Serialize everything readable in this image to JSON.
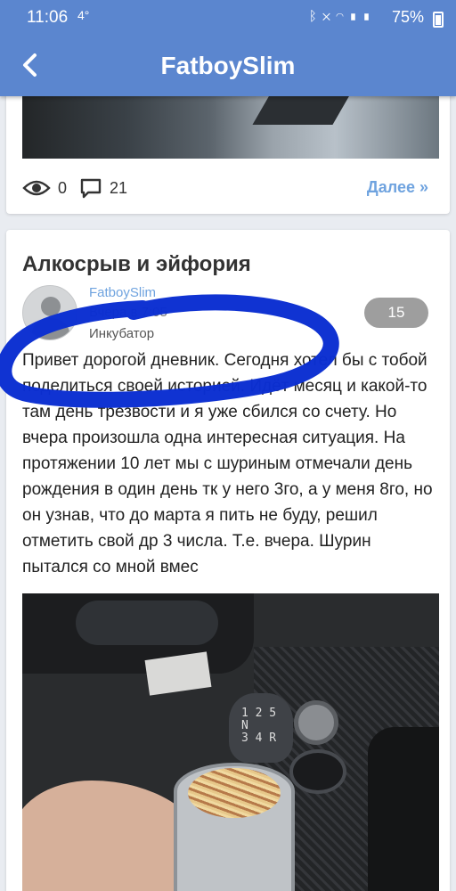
{
  "status_bar": {
    "time": "11:06",
    "temperature": "4°",
    "battery": "75%",
    "icons": [
      "bluetooth-icon",
      "mute-icon",
      "wifi-icon",
      "signal-icon",
      "signal-icon",
      "battery-icon"
    ]
  },
  "app_bar": {
    "title": "FatboySlim",
    "back_icon": "back-arrow-icon",
    "color": "#5b86cf"
  },
  "previous_post": {
    "views": "0",
    "comments": "21",
    "more_label": "Далее »"
  },
  "post": {
    "title": "Алкосрыв и эйфория",
    "author": "FatboySlim",
    "date": "Вчера в 7:05",
    "group": "Инкубатор",
    "badge": "15",
    "text": "Привет дорогой дневник. Сегодня хотел бы с тобой поделиться своей историей. Идёт месяц и какой-то там день трезвости и я уже сбился со счету. Но вчера произошла одна интересная ситуация. На протяжении 10 лет мы с шуриным отмечали день рождения в один день тк у него 3го, а у меня 8го, но он узнав, что до марта я пить не буду, решил отметить свой др 3 числа. Т.е. вчера. Шурин пытался со мной вмес",
    "photo_label": "1 2 5\nN\n3 4 R"
  },
  "colors": {
    "accent": "#6fa3df",
    "marker": "#0b2fd1",
    "badge": "#9e9e9e"
  }
}
